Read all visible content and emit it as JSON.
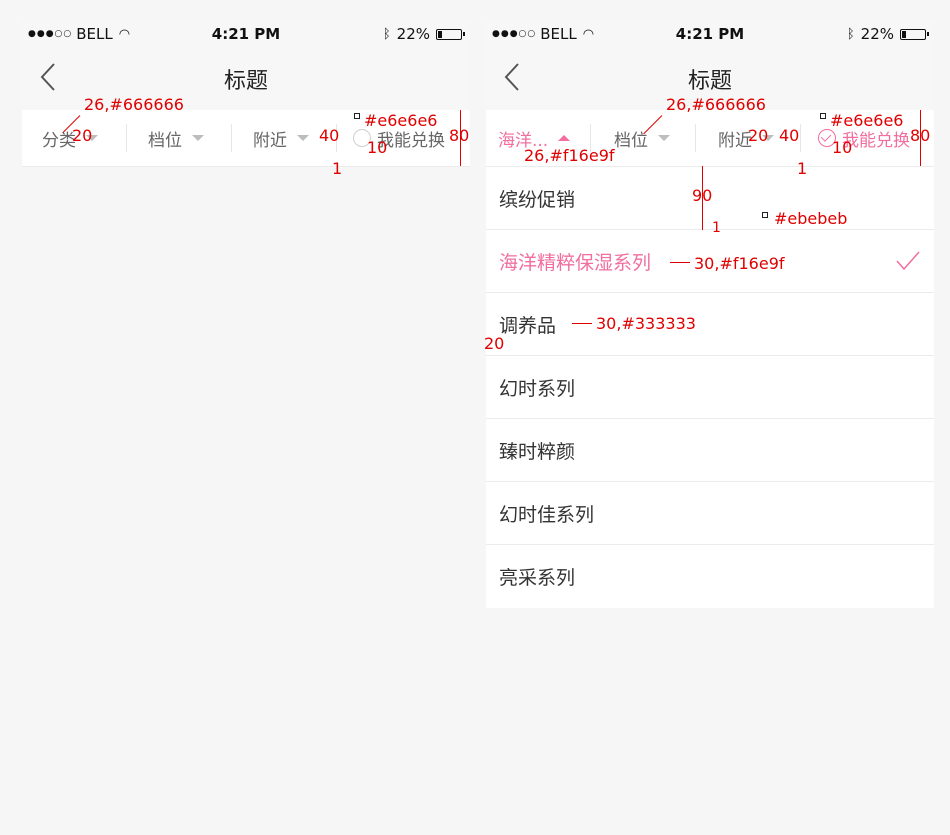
{
  "status_bar": {
    "carrier": "BELL",
    "time": "4:21 PM",
    "battery": "22%",
    "battery_level": 0.22
  },
  "nav": {
    "title": "标题"
  },
  "left_screen": {
    "filters": [
      "分类",
      "档位",
      "附近"
    ],
    "redeem_label": "我能兑换",
    "redeem_checked": false
  },
  "right_screen": {
    "filters": [
      "海洋...",
      "档位",
      "附近"
    ],
    "redeem_label": "我能兑换",
    "redeem_checked": true,
    "list": [
      {
        "label": "缤纷促销",
        "selected": false
      },
      {
        "label": "海洋精粹保湿系列",
        "selected": true
      },
      {
        "label": "调养品",
        "selected": false
      },
      {
        "label": "幻时系列",
        "selected": false
      },
      {
        "label": "臻时粹颜",
        "selected": false
      },
      {
        "label": "幻时佳系列",
        "selected": false
      },
      {
        "label": "亮采系列",
        "selected": false
      }
    ]
  },
  "annotations": {
    "left": {
      "font": "26,#666666",
      "padding": "20",
      "divider_color": "#e6e6e6",
      "divider_h": "40",
      "radio_gap": "10",
      "divider_w": "1",
      "bar_h": "80"
    },
    "right": {
      "font": "26,#666666",
      "active_font": "26,#f16e9f",
      "padding": "20",
      "divider_color": "#e6e6e6",
      "divider_h": "40",
      "radio_gap": "10",
      "divider_w": "1",
      "bar_h": "80",
      "row_h": "90",
      "row_line": "1",
      "row_line_color": "#ebebeb",
      "selected_font": "30,#f16e9f",
      "item_font": "30,#333333",
      "item_padding": "20"
    }
  },
  "colors": {
    "accent": "#f16e9f",
    "text": "#333333",
    "muted": "#666666",
    "divider": "#e6e6e6",
    "row_line": "#ebebeb"
  }
}
